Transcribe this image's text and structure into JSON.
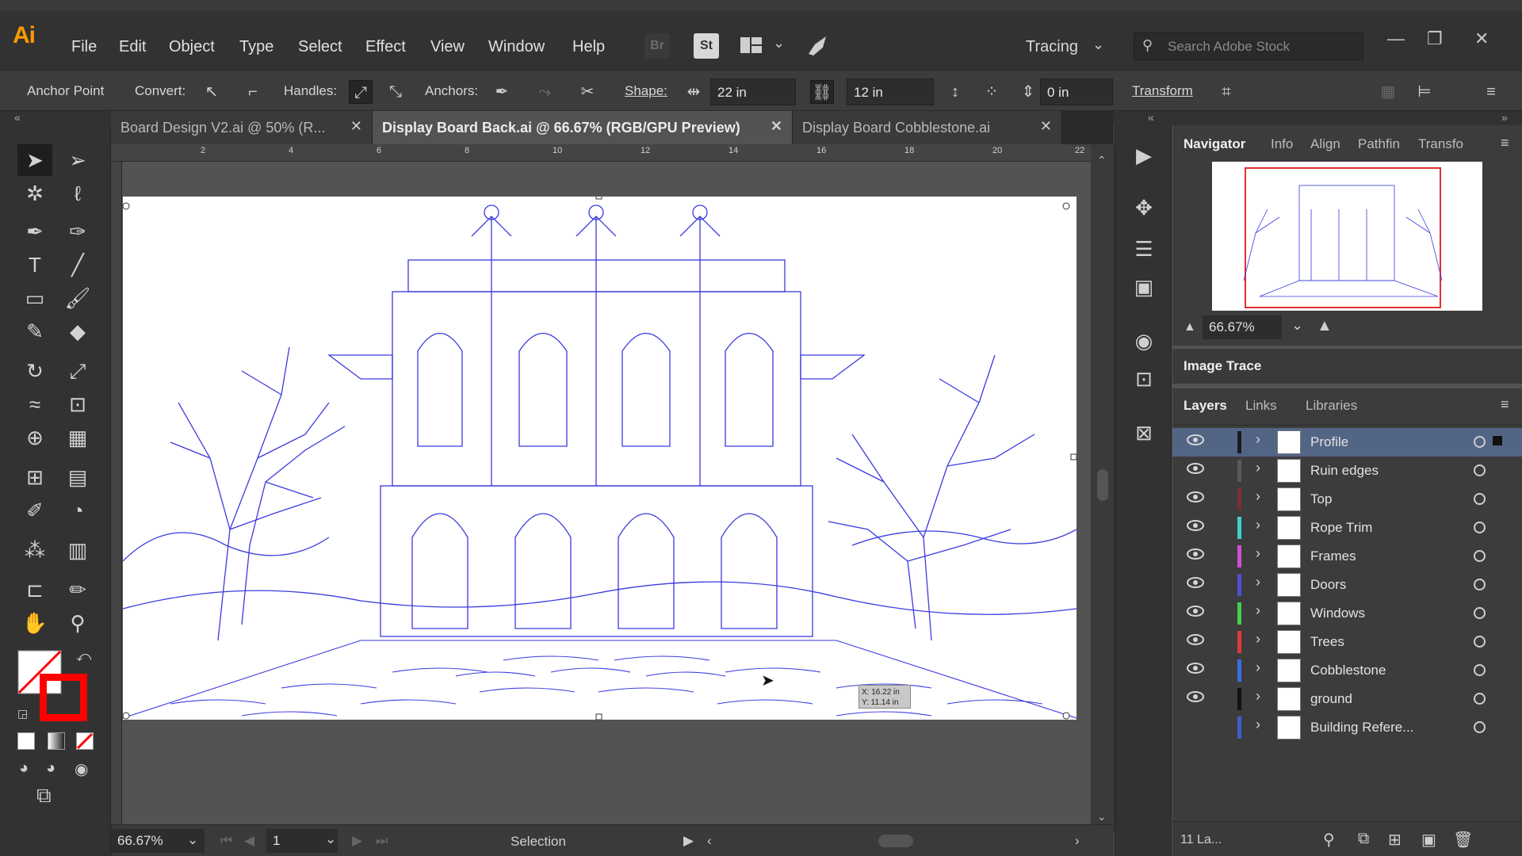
{
  "app": {
    "logo": "Ai"
  },
  "menu": [
    "File",
    "Edit",
    "Object",
    "Type",
    "Select",
    "Effect",
    "View",
    "Window",
    "Help"
  ],
  "menubar_icons": {
    "bridge": "Br",
    "stock": "St"
  },
  "workspace": {
    "label": "Tracing"
  },
  "search": {
    "placeholder": "Search Adobe Stock"
  },
  "control": {
    "anchor_point": "Anchor Point",
    "convert": "Convert:",
    "handles": "Handles:",
    "anchors": "Anchors:",
    "shape": "Shape:",
    "width": "22 in",
    "height": "12 in",
    "offset": "0 in",
    "transform": "Transform"
  },
  "tabs": [
    {
      "label": "Board Design V2.ai @ 50% (R...",
      "active": false
    },
    {
      "label": "Display Board Back.ai @ 66.67% (RGB/GPU Preview)",
      "active": true
    },
    {
      "label": "Display Board Cobblestone.ai",
      "active": false
    }
  ],
  "ruler_ticks": [
    "2",
    "4",
    "6",
    "8",
    "10",
    "12",
    "14",
    "16",
    "18",
    "20",
    "22"
  ],
  "cursor_readout": {
    "x": "X: 16.22 in",
    "y": "Y: 11.14 in"
  },
  "status": {
    "zoom": "66.67%",
    "artboard": "1",
    "tool": "Selection"
  },
  "panels": {
    "nav_tabs": [
      "Navigator",
      "Info",
      "Align",
      "Pathfin",
      "Transfo"
    ],
    "nav_zoom": "66.67%",
    "image_trace": "Image Trace",
    "layer_tabs": [
      "Layers",
      "Links",
      "Libraries"
    ],
    "layers_count": "11 La..."
  },
  "layers": [
    {
      "name": "Profile",
      "color": "#1a1a1a",
      "visible": true,
      "selected": true
    },
    {
      "name": "Ruin edges",
      "color": "#5a5a5a",
      "visible": true,
      "selected": false
    },
    {
      "name": "Top",
      "color": "#7a3030",
      "visible": true,
      "selected": false
    },
    {
      "name": "Rope Trim",
      "color": "#3fd1d1",
      "visible": true,
      "selected": false
    },
    {
      "name": "Frames",
      "color": "#d14fd1",
      "visible": true,
      "selected": false
    },
    {
      "name": "Doors",
      "color": "#4f4fd1",
      "visible": true,
      "selected": false
    },
    {
      "name": "Windows",
      "color": "#3fd14f",
      "visible": true,
      "selected": false
    },
    {
      "name": "Trees",
      "color": "#e03a3a",
      "visible": true,
      "selected": false
    },
    {
      "name": "Cobblestone",
      "color": "#3a6fe0",
      "visible": true,
      "selected": false
    },
    {
      "name": "ground",
      "color": "#111111",
      "visible": true,
      "selected": false
    },
    {
      "name": "Building Refere...",
      "color": "#3a5fd0",
      "visible": false,
      "selected": false
    }
  ],
  "colors": {
    "accent_selection": "#536585",
    "artwork_stroke": "#3a3ae0",
    "stroke_red": "#ff0000"
  }
}
